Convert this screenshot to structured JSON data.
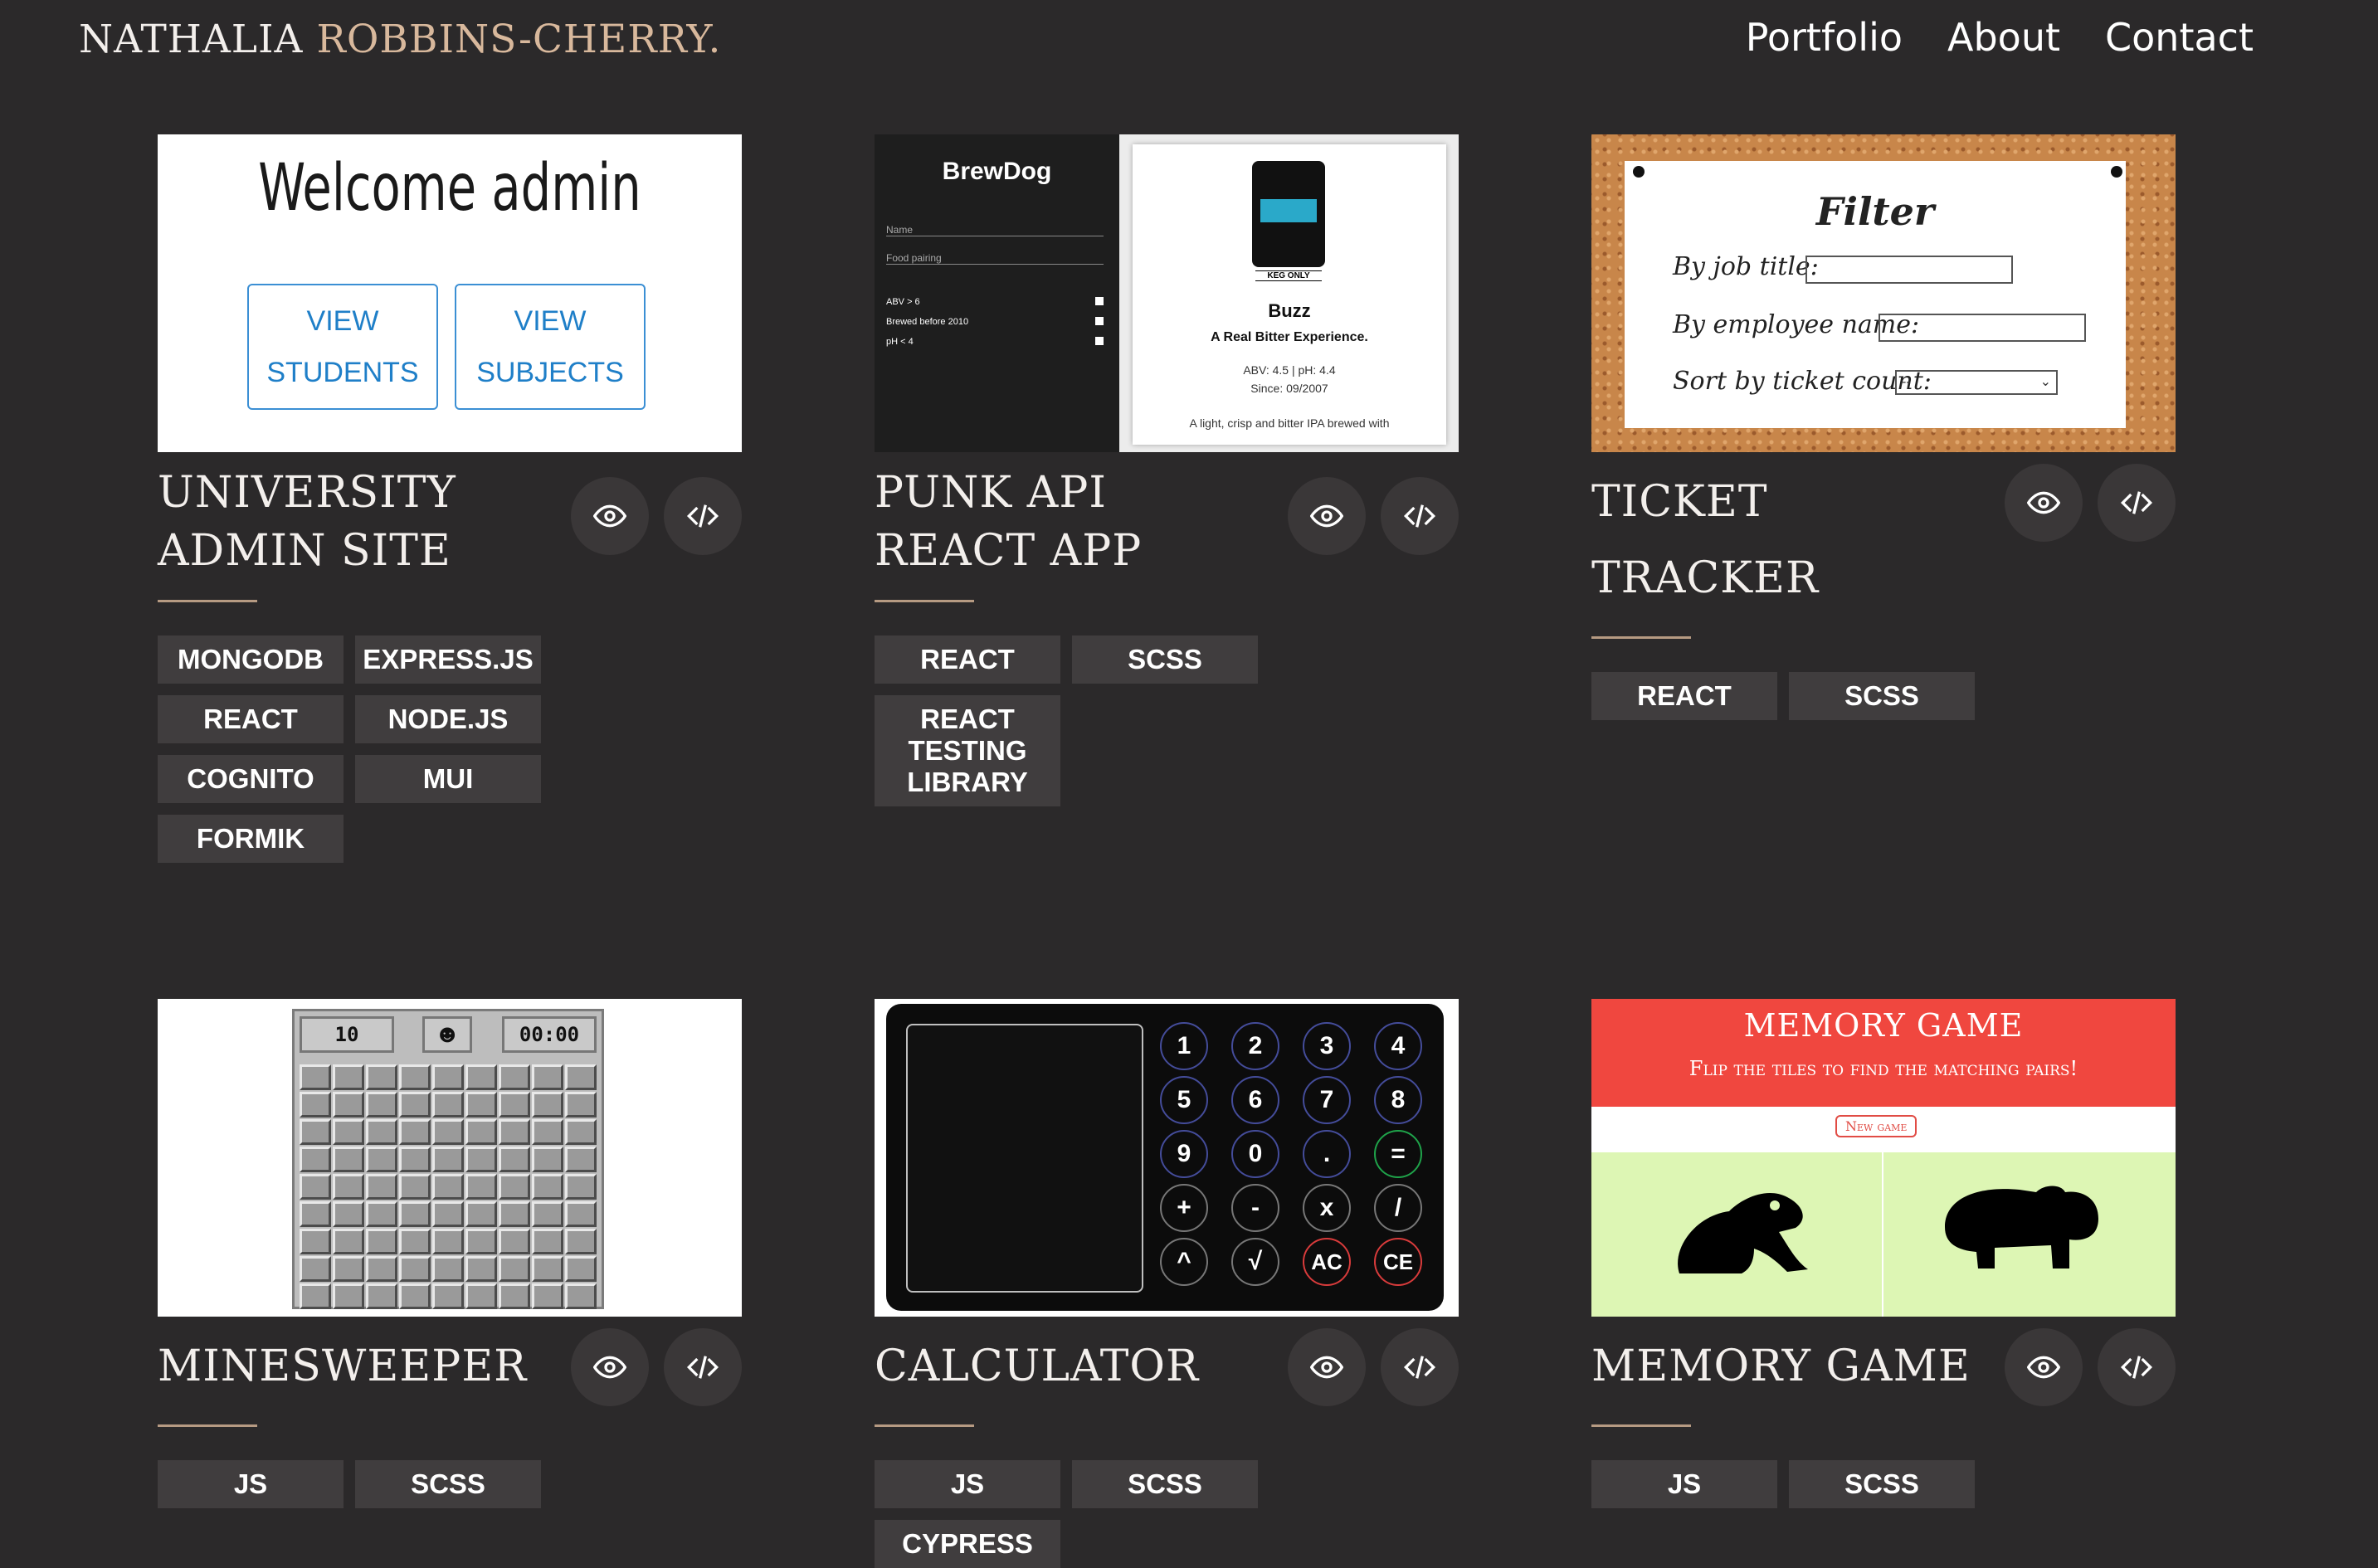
{
  "header": {
    "brand_first": "NATHALIA",
    "brand_last": "ROBBINS-CHERRY.",
    "nav": [
      "Portfolio",
      "About",
      "Contact"
    ]
  },
  "projects": [
    {
      "title": "UNIVERSITY ADMIN SITE",
      "tags": [
        "MONGODB",
        "EXPRESS.JS",
        "REACT",
        "NODE.JS",
        "COGNITO",
        "MUI",
        "FORMIK"
      ],
      "preview": {
        "heading": "Welcome admin",
        "button1": "VIEW STUDENTS",
        "button2": "VIEW SUBJECTS"
      }
    },
    {
      "title": "PUNK API REACT APP",
      "tags": [
        "REACT",
        "SCSS",
        "REACT TESTING LIBRARY"
      ],
      "preview": {
        "logo": "BrewDog",
        "name_placeholder": "Name",
        "food_placeholder": "Food pairing",
        "filters": [
          "ABV > 6",
          "Brewed before 2010",
          "pH < 4"
        ],
        "beer_label": "KEG ONLY",
        "beer_name": "Buzz",
        "tagline": "A Real Bitter Experience.",
        "stats": "ABV: 4.5 | pH: 4.4",
        "since": "Since: 09/2007",
        "description": "A light, crisp and bitter IPA brewed with"
      }
    },
    {
      "title": "TICKET TRACKER",
      "tags": [
        "REACT",
        "SCSS"
      ],
      "preview": {
        "heading": "Filter",
        "label1": "By job title:",
        "label2": "By employee name:",
        "label3": "Sort by ticket count:",
        "select_value": "--"
      }
    },
    {
      "title": "MINESWEEPER",
      "tags": [
        "JS",
        "SCSS"
      ],
      "preview": {
        "mines": "10",
        "timer": "00:00",
        "face": "☻"
      }
    },
    {
      "title": "CALCULATOR",
      "tags": [
        "JS",
        "SCSS",
        "CYPRESS"
      ],
      "preview": {
        "keys": [
          "1",
          "2",
          "3",
          "4",
          "5",
          "6",
          "7",
          "8",
          "9",
          "0",
          ".",
          "=",
          "+",
          "-",
          "x",
          "/",
          "^",
          "√",
          "AC",
          "CE"
        ]
      }
    },
    {
      "title": "MEMORY GAME",
      "tags": [
        "JS",
        "SCSS"
      ],
      "preview": {
        "heading": "MEMORY GAME",
        "subheading": "Flip the tiles to find the matching pairs!",
        "button": "New game"
      }
    }
  ],
  "colors": {
    "background": "#2b292a",
    "accent": "#d8b89c",
    "tag_bg": "#403d3e",
    "icon_bg": "#3a3738"
  },
  "icons": {
    "view": "eye-icon",
    "code": "code-icon"
  }
}
